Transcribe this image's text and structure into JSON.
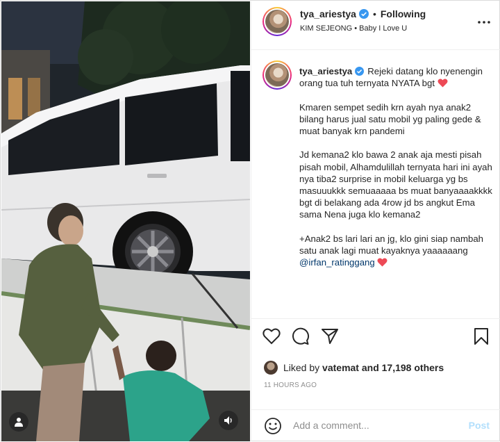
{
  "post": {
    "username": "tya_ariestya",
    "verified": true,
    "follow_status": "Following",
    "separator": "•",
    "music": "KIM SEJEONG • Baby I Love U",
    "caption_username": "tya_ariestya",
    "caption_line1": "Rejeki datang klo nyenengin orang tua tuh ternyata NYATA bgt",
    "caption_p2": "Kmaren sempet sedih krn ayah nya anak2 bilang harus jual satu mobil yg paling gede & muat banyak krn pandemi",
    "caption_p3": "Jd kemana2 klo bawa 2 anak aja mesti pisah pisah mobil, Alhamdulillah ternyata hari ini ayah nya tiba2 surprise in mobil keluarga yg bs masuuukkk semuaaaaa bs muat banyaaaakkkk bgt di belakang ada 4row jd bs angkut Ema sama Nena juga klo kemana2",
    "caption_p4": "+Anak2 bs lari lari an jg, klo gini siap nambah satu anak lagi muat kayaknya yaaaaaang",
    "mention": "@irfan_ratinggang",
    "likes_prefix": "Liked by",
    "likes_user": "vatemat",
    "likes_suffix": "and 17,198 others",
    "timestamp": "11 HOURS AGO",
    "comment_placeholder": "Add a comment...",
    "post_label": "Post"
  },
  "icons": {
    "more": "more-options-icon",
    "like": "heart-icon",
    "comment": "comment-icon",
    "share": "share-icon",
    "save": "bookmark-icon",
    "emoji": "emoji-icon",
    "user_tag": "user-tag-icon",
    "audio": "speaker-icon"
  },
  "colors": {
    "verified": "#3897f0",
    "heart": "#ed4956",
    "mention": "#00376b",
    "post_disabled": "#b2dffc"
  }
}
